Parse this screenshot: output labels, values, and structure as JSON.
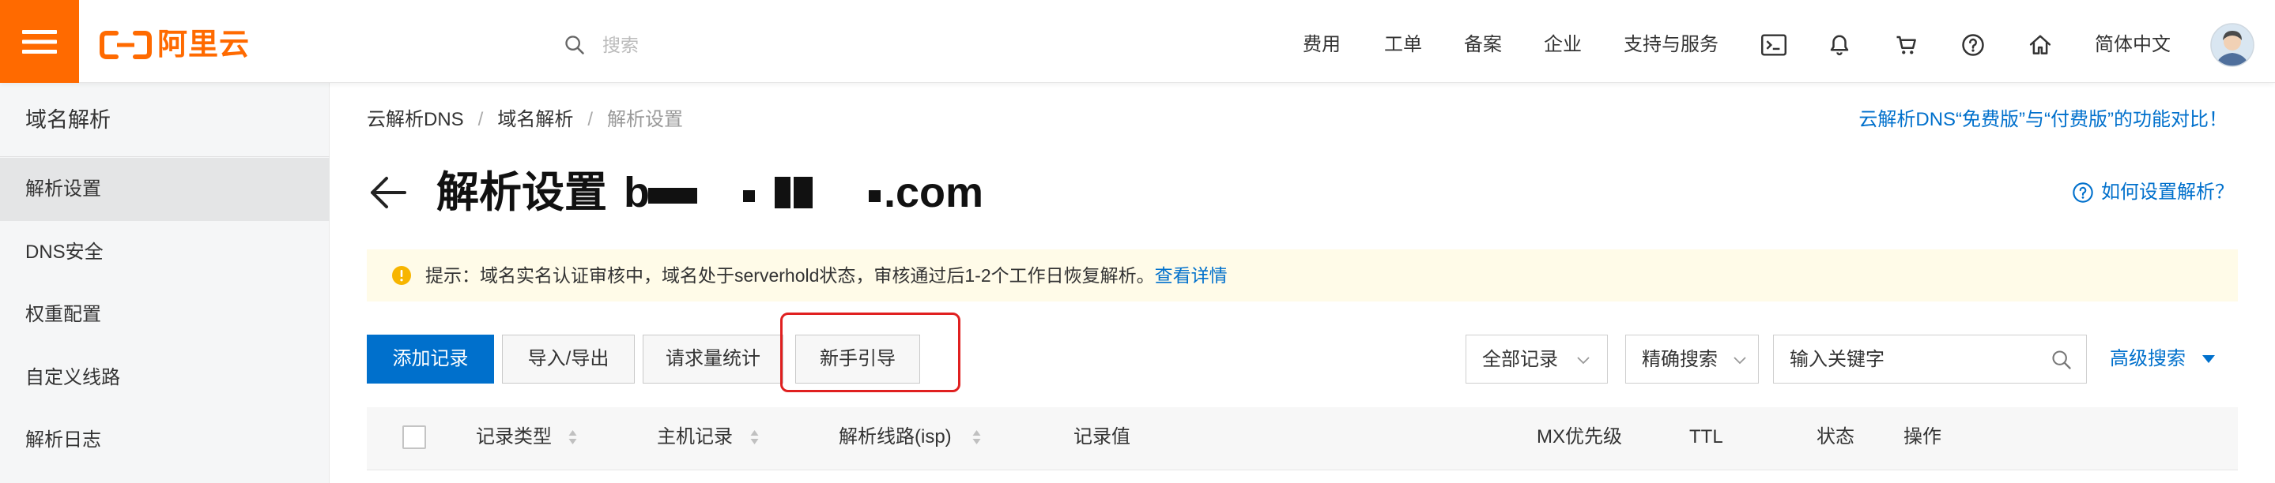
{
  "topbar": {
    "logo_text": "阿里云",
    "search_placeholder": "搜索",
    "nav": [
      "费用",
      "工单",
      "备案",
      "企业",
      "支持与服务"
    ],
    "icons": [
      "terminal-icon",
      "bell-icon",
      "cart-icon",
      "help-icon",
      "home-icon"
    ],
    "language": "简体中文"
  },
  "sidebar": {
    "title": "域名解析",
    "items": [
      {
        "label": "解析设置",
        "active": true
      },
      {
        "label": "DNS安全",
        "active": false
      },
      {
        "label": "权重配置",
        "active": false
      },
      {
        "label": "自定义线路",
        "active": false
      },
      {
        "label": "解析日志",
        "active": false
      }
    ]
  },
  "breadcrumb": {
    "items": [
      "云解析DNS",
      "域名解析",
      "解析设置"
    ],
    "separator": "/"
  },
  "compare_link": "云解析DNS“免费版”与“付费版”的功能对比！",
  "page": {
    "title": "解析设置",
    "domain_prefix": "b",
    "domain_suffix": ".com",
    "domain_redacted": true,
    "help_link": "如何设置解析？"
  },
  "notice": {
    "text": "提示：域名实名认证审核中，域名处于serverhold状态，审核通过后1-2个工作日恢复解析。",
    "link": "查看详情"
  },
  "toolbar": {
    "buttons": [
      "添加记录",
      "导入/导出",
      "请求量统计",
      "新手引导"
    ],
    "highlighted_button": "新手引导",
    "record_filter": "全部记录",
    "search_mode": "精确搜索",
    "keyword_placeholder": "输入关键字",
    "advanced_search": "高级搜索"
  },
  "table": {
    "columns": [
      "记录类型",
      "主机记录",
      "解析线路(isp)",
      "记录值",
      "MX优先级",
      "TTL",
      "状态",
      "操作"
    ],
    "sortable": [
      true,
      true,
      true,
      false,
      false,
      false,
      false,
      false
    ]
  },
  "colors": {
    "brand": "#ff6a00",
    "primary": "#0070cc",
    "highlight_box": "#e02020",
    "notice_bg": "#fffbe8"
  }
}
